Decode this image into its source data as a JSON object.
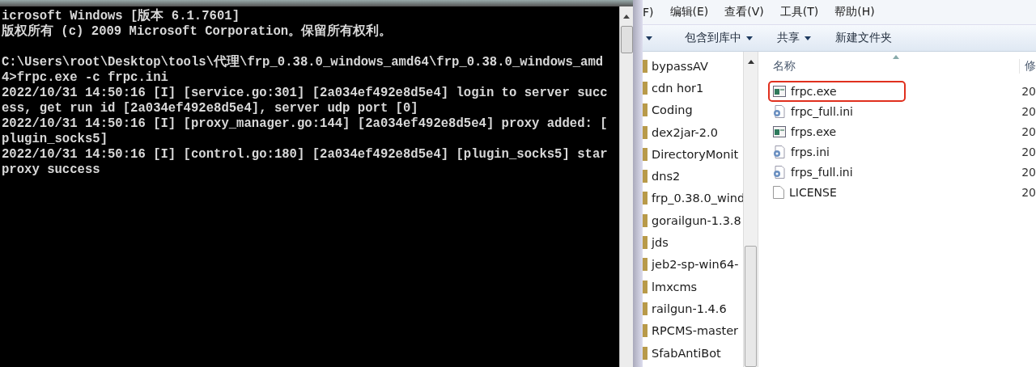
{
  "console": {
    "paragraphs": [
      {
        "lines": [
          "icrosoft Windows [版本 6.1.7601]",
          "版权所有 (c) 2009 Microsoft Corporation。保留所有权利。"
        ]
      },
      {
        "lines": [
          "C:\\Users\\root\\Desktop\\tools\\代理\\frp_0.38.0_windows_amd64\\frp_0.38.0_windows_amd",
          "4>frpc.exe -c frpc.ini",
          "2022/10/31 14:50:16 [I] [service.go:301] [2a034ef492e8d5e4] login to server succ",
          "ess, get run id [2a034ef492e8d5e4], server udp port [0]",
          "2022/10/31 14:50:16 [I] [proxy_manager.go:144] [2a034ef492e8d5e4] proxy added: [",
          "plugin_socks5]",
          "2022/10/31 14:50:16 [I] [control.go:180] [2a034ef492e8d5e4] [plugin_socks5] star",
          "proxy success"
        ]
      }
    ]
  },
  "explorer": {
    "menu": [
      "F)",
      "编辑(E)",
      "查看(V)",
      "工具(T)",
      "帮助(H)"
    ],
    "toolbar": [
      {
        "label": "包含到库中",
        "dropdown": true
      },
      {
        "label": "共享",
        "dropdown": true
      },
      {
        "label": "新建文件夹",
        "dropdown": false
      }
    ],
    "sidebar": {
      "items": [
        "bypassAV",
        "cdn hor1",
        "Coding",
        "dex2jar-2.0",
        "DirectoryMonit",
        "dns2",
        "frp_0.38.0_wind",
        "gorailgun-1.3.8",
        "jds",
        "jeb2-sp-win64-",
        "lmxcms",
        "railgun-1.4.6",
        "RPCMS-master",
        "SfabAntiBot"
      ]
    },
    "columns": [
      "名称",
      "修"
    ],
    "files": [
      {
        "name": "frpc.exe",
        "kind": "exe",
        "date": "20",
        "highlighted": true
      },
      {
        "name": "frpc_full.ini",
        "kind": "ini",
        "date": "20",
        "highlighted": false
      },
      {
        "name": "frps.exe",
        "kind": "exe",
        "date": "20",
        "highlighted": false
      },
      {
        "name": "frps.ini",
        "kind": "ini",
        "date": "20",
        "highlighted": false
      },
      {
        "name": "frps_full.ini",
        "kind": "ini",
        "date": "20",
        "highlighted": false
      },
      {
        "name": "LICENSE",
        "kind": "file",
        "date": "20",
        "highlighted": false
      }
    ]
  }
}
